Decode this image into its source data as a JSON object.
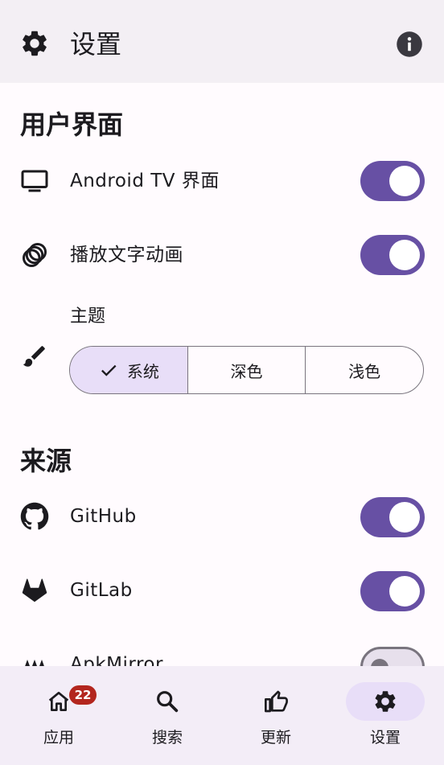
{
  "topbar": {
    "title": "设置",
    "left_icon": "gear-icon",
    "right_icon": "info-icon"
  },
  "ui_section": {
    "title": "用户界面",
    "items": [
      {
        "icon": "tv-icon",
        "label": "Android TV 界面",
        "enabled": true
      },
      {
        "icon": "animation-rings-icon",
        "label": "播放文字动画",
        "enabled": true
      }
    ],
    "theme": {
      "label": "主题",
      "icon": "brush-icon",
      "options": [
        "系统",
        "深色",
        "浅色"
      ],
      "selected": "系统"
    }
  },
  "sources_section": {
    "title": "来源",
    "items": [
      {
        "icon": "github-icon",
        "label": "GitHub",
        "enabled": true
      },
      {
        "icon": "gitlab-icon",
        "label": "GitLab",
        "enabled": true
      },
      {
        "icon": "apkmirror-icon",
        "label": "ApkMirror",
        "enabled": false
      }
    ]
  },
  "bottom_nav": {
    "items": [
      {
        "icon": "home-icon",
        "label": "应用",
        "badge": "22"
      },
      {
        "icon": "search-icon",
        "label": "搜索"
      },
      {
        "icon": "thumbs-up-icon",
        "label": "更新"
      },
      {
        "icon": "gear-icon",
        "label": "设置",
        "active": true
      }
    ]
  },
  "colors": {
    "accent": "#6750a4",
    "selected_bg": "#e8def8",
    "badge": "#b3261e",
    "nav_bg": "#f3edf7"
  }
}
